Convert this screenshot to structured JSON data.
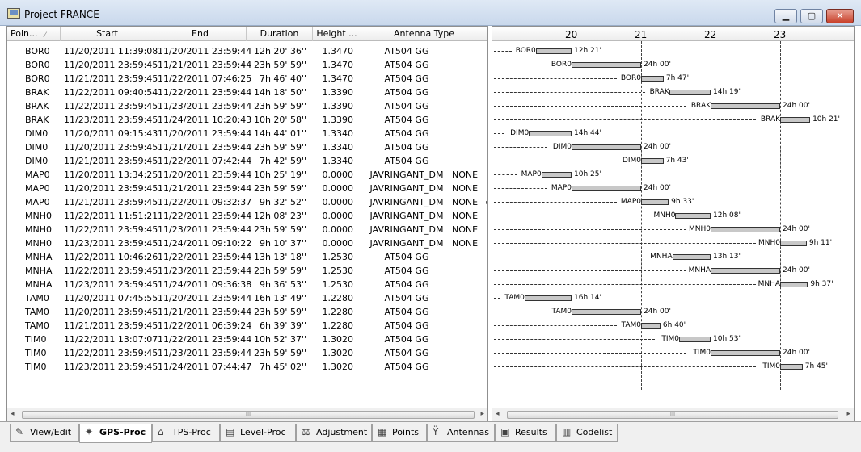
{
  "window": {
    "title": "Project FRANCE",
    "min_label": "▁",
    "max_label": "▢",
    "close_label": "✕"
  },
  "table": {
    "columns": [
      "Poin...",
      "Start",
      "End",
      "Duration",
      "Height ...",
      "Antenna Type"
    ],
    "sort_indicator": "⁄",
    "rows": [
      [
        "BOR0",
        "11/20/2011 11:39:08",
        "11/20/2011 23:59:44",
        "12h 20' 36''",
        "1.3470",
        "AT504 GG",
        ""
      ],
      [
        "BOR0",
        "11/20/2011 23:59:45",
        "11/21/2011 23:59:44",
        "23h 59' 59''",
        "1.3470",
        "AT504 GG",
        ""
      ],
      [
        "BOR0",
        "11/21/2011 23:59:45",
        "11/22/2011 07:46:25",
        "7h 46' 40''",
        "1.3470",
        "AT504 GG",
        ""
      ],
      [
        "BRAK",
        "11/22/2011 09:40:54",
        "11/22/2011 23:59:44",
        "14h 18' 50''",
        "1.3390",
        "AT504 GG",
        ""
      ],
      [
        "BRAK",
        "11/22/2011 23:59:45",
        "11/23/2011 23:59:44",
        "23h 59' 59''",
        "1.3390",
        "AT504 GG",
        ""
      ],
      [
        "BRAK",
        "11/23/2011 23:59:45",
        "11/24/2011 10:20:43",
        "10h 20' 58''",
        "1.3390",
        "AT504 GG",
        ""
      ],
      [
        "DIM0",
        "11/20/2011 09:15:43",
        "11/20/2011 23:59:44",
        "14h 44' 01''",
        "1.3340",
        "AT504 GG",
        ""
      ],
      [
        "DIM0",
        "11/20/2011 23:59:45",
        "11/21/2011 23:59:44",
        "23h 59' 59''",
        "1.3340",
        "AT504 GG",
        ""
      ],
      [
        "DIM0",
        "11/21/2011 23:59:45",
        "11/22/2011 07:42:44",
        "7h 42' 59''",
        "1.3340",
        "AT504 GG",
        ""
      ],
      [
        "MAP0",
        "11/20/2011 13:34:25",
        "11/20/2011 23:59:44",
        "10h 25' 19''",
        "0.0000",
        "JAVRINGANT_DM",
        "NONE"
      ],
      [
        "MAP0",
        "11/20/2011 23:59:45",
        "11/21/2011 23:59:44",
        "23h 59' 59''",
        "0.0000",
        "JAVRINGANT_DM",
        "NONE"
      ],
      [
        "MAP0",
        "11/21/2011 23:59:45",
        "11/22/2011 09:32:37",
        "9h 32' 52''",
        "0.0000",
        "JAVRINGANT_DM",
        "NONE"
      ],
      [
        "MNH0",
        "11/22/2011 11:51:21",
        "11/22/2011 23:59:44",
        "12h 08' 23''",
        "0.0000",
        "JAVRINGANT_DM",
        "NONE"
      ],
      [
        "MNH0",
        "11/22/2011 23:59:45",
        "11/23/2011 23:59:44",
        "23h 59' 59''",
        "0.0000",
        "JAVRINGANT_DM",
        "NONE"
      ],
      [
        "MNH0",
        "11/23/2011 23:59:45",
        "11/24/2011 09:10:22",
        "9h 10' 37''",
        "0.0000",
        "JAVRINGANT_DM",
        "NONE"
      ],
      [
        "MNHA",
        "11/22/2011 10:46:26",
        "11/22/2011 23:59:44",
        "13h 13' 18''",
        "1.2530",
        "AT504 GG",
        ""
      ],
      [
        "MNHA",
        "11/22/2011 23:59:45",
        "11/23/2011 23:59:44",
        "23h 59' 59''",
        "1.2530",
        "AT504 GG",
        ""
      ],
      [
        "MNHA",
        "11/23/2011 23:59:45",
        "11/24/2011 09:36:38",
        "9h 36' 53''",
        "1.2530",
        "AT504 GG",
        ""
      ],
      [
        "TAM0",
        "11/20/2011 07:45:55",
        "11/20/2011 23:59:44",
        "16h 13' 49''",
        "1.2280",
        "AT504 GG",
        ""
      ],
      [
        "TAM0",
        "11/20/2011 23:59:45",
        "11/21/2011 23:59:44",
        "23h 59' 59''",
        "1.2280",
        "AT504 GG",
        ""
      ],
      [
        "TAM0",
        "11/21/2011 23:59:45",
        "11/22/2011 06:39:24",
        "6h 39' 39''",
        "1.2280",
        "AT504 GG",
        ""
      ],
      [
        "TIM0",
        "11/22/2011 13:07:07",
        "11/22/2011 23:59:44",
        "10h 52' 37''",
        "1.3020",
        "AT504 GG",
        ""
      ],
      [
        "TIM0",
        "11/22/2011 23:59:45",
        "11/23/2011 23:59:44",
        "23h 59' 59''",
        "1.3020",
        "AT504 GG",
        ""
      ],
      [
        "TIM0",
        "11/23/2011 23:59:45",
        "11/24/2011 07:44:47",
        "7h 45' 02''",
        "1.3020",
        "AT504 GG",
        ""
      ]
    ],
    "row_marker": "▸"
  },
  "timeline": {
    "day_labels": [
      "20",
      "21",
      "22",
      "23"
    ],
    "bars": [
      {
        "label": "BOR0",
        "start": 19.486,
        "end": 20.0,
        "dur": "12h 21'"
      },
      {
        "label": "BOR0",
        "start": 20.0,
        "end": 21.0,
        "dur": "24h 00'"
      },
      {
        "label": "BOR0",
        "start": 21.0,
        "end": 21.324,
        "dur": "7h 47'"
      },
      {
        "label": "BRAK",
        "start": 21.404,
        "end": 22.0,
        "dur": "14h 19'"
      },
      {
        "label": "BRAK",
        "start": 22.0,
        "end": 23.0,
        "dur": "24h 00'"
      },
      {
        "label": "BRAK",
        "start": 23.0,
        "end": 23.431,
        "dur": "10h 21'"
      },
      {
        "label": "DIM0",
        "start": 19.386,
        "end": 20.0,
        "dur": "14h 44'"
      },
      {
        "label": "DIM0",
        "start": 20.0,
        "end": 21.0,
        "dur": "24h 00'"
      },
      {
        "label": "DIM0",
        "start": 21.0,
        "end": 21.321,
        "dur": "7h 43'"
      },
      {
        "label": "MAP0",
        "start": 19.566,
        "end": 20.0,
        "dur": "10h 25'"
      },
      {
        "label": "MAP0",
        "start": 20.0,
        "end": 21.0,
        "dur": "24h 00'"
      },
      {
        "label": "MAP0",
        "start": 21.0,
        "end": 21.397,
        "dur": "9h 33'"
      },
      {
        "label": "MNH0",
        "start": 21.494,
        "end": 22.0,
        "dur": "12h 08'"
      },
      {
        "label": "MNH0",
        "start": 22.0,
        "end": 23.0,
        "dur": "24h 00'"
      },
      {
        "label": "MNH0",
        "start": 23.0,
        "end": 23.382,
        "dur": "9h 11'"
      },
      {
        "label": "MNHA",
        "start": 21.449,
        "end": 22.0,
        "dur": "13h 13'"
      },
      {
        "label": "MNHA",
        "start": 22.0,
        "end": 23.0,
        "dur": "24h 00'"
      },
      {
        "label": "MNHA",
        "start": 23.0,
        "end": 23.4,
        "dur": "9h 37'"
      },
      {
        "label": "TAM0",
        "start": 19.324,
        "end": 20.0,
        "dur": "16h 14'"
      },
      {
        "label": "TAM0",
        "start": 20.0,
        "end": 21.0,
        "dur": "24h 00'"
      },
      {
        "label": "TAM0",
        "start": 21.0,
        "end": 21.278,
        "dur": "6h 40'"
      },
      {
        "label": "TIM0",
        "start": 21.547,
        "end": 22.0,
        "dur": "10h 53'"
      },
      {
        "label": "TIM0",
        "start": 22.0,
        "end": 23.0,
        "dur": "24h 00'"
      },
      {
        "label": "TIM0",
        "start": 23.0,
        "end": 23.323,
        "dur": "7h 45'"
      }
    ]
  },
  "scroll": {
    "left_arrow": "◂",
    "right_arrow": "▸",
    "grip": "III"
  },
  "tabs": [
    {
      "label": "View/Edit",
      "icon": "view-edit-icon",
      "glyph": "✎"
    },
    {
      "label": "GPS-Proc",
      "icon": "satellite-icon",
      "glyph": "✷"
    },
    {
      "label": "TPS-Proc",
      "icon": "total-station-icon",
      "glyph": "⌂"
    },
    {
      "label": "Level-Proc",
      "icon": "level-icon",
      "glyph": "▤"
    },
    {
      "label": "Adjustment",
      "icon": "scale-icon",
      "glyph": "⚖"
    },
    {
      "label": "Points",
      "icon": "points-icon",
      "glyph": "▦"
    },
    {
      "label": "Antennas",
      "icon": "antenna-icon",
      "glyph": "Ÿ"
    },
    {
      "label": "Results",
      "icon": "printer-icon",
      "glyph": "▣"
    },
    {
      "label": "Codelist",
      "icon": "codelist-icon",
      "glyph": "▥"
    }
  ],
  "active_tab": "GPS-Proc"
}
